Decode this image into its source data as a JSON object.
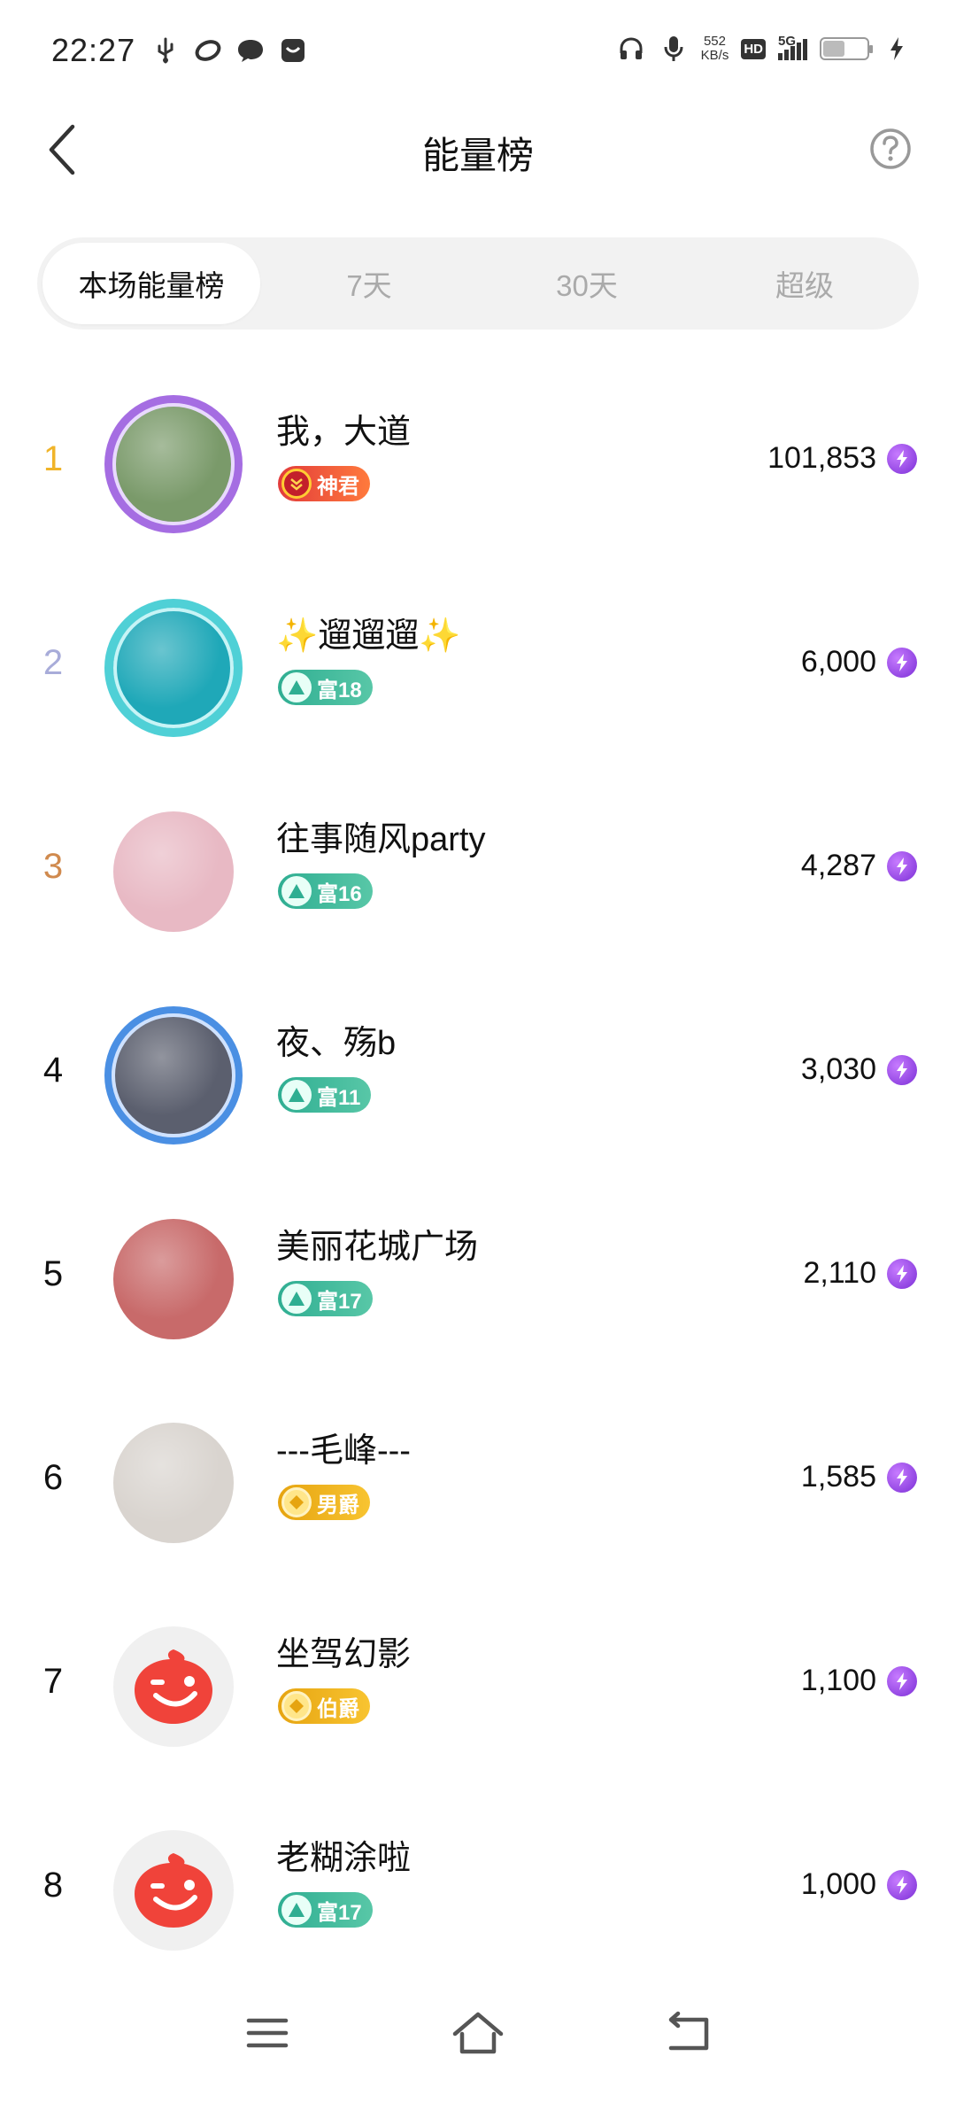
{
  "status_bar": {
    "time": "22:27",
    "left_icons": [
      "usb-icon",
      "link-icon",
      "chat-bubble-icon",
      "app-icon"
    ],
    "speed_value": "552",
    "speed_unit": "KB/s",
    "hd_label": "HD",
    "network_label": "5G",
    "battery_level": 0.5
  },
  "header": {
    "title": "能量榜"
  },
  "tabs": [
    {
      "label": "本场能量榜",
      "active": true
    },
    {
      "label": "7天",
      "active": false
    },
    {
      "label": "30天",
      "active": false
    },
    {
      "label": "超级",
      "active": false
    }
  ],
  "rankings": [
    {
      "rank": "1",
      "name": "我，大道",
      "badge": "神君",
      "badge_type": "red",
      "energy": "101,853",
      "avatar_frame": "purple",
      "avatar_color": "#7a9a6a"
    },
    {
      "rank": "2",
      "name": "✨遛遛遛✨",
      "badge": "富18",
      "badge_type": "green",
      "energy": "6,000",
      "avatar_frame": "teal",
      "avatar_color": "#1fa8b8"
    },
    {
      "rank": "3",
      "name": "往事随风party",
      "badge": "富16",
      "badge_type": "green",
      "energy": "4,287",
      "avatar_frame": "none",
      "avatar_color": "#e8b9c4"
    },
    {
      "rank": "4",
      "name": "夜、殇b",
      "badge": "富11",
      "badge_type": "green",
      "energy": "3,030",
      "avatar_frame": "blue",
      "avatar_color": "#5b5f6e"
    },
    {
      "rank": "5",
      "name": "美丽花城广场",
      "badge": "富17",
      "badge_type": "green",
      "energy": "2,110",
      "avatar_frame": "none",
      "avatar_color": "#c86a6a"
    },
    {
      "rank": "6",
      "name": "---毛峰---",
      "badge": "男爵",
      "badge_type": "gold",
      "energy": "1,585",
      "avatar_frame": "none",
      "avatar_color": "#d9d4cf"
    },
    {
      "rank": "7",
      "name": "坐驾幻影",
      "badge": "伯爵",
      "badge_type": "gold",
      "energy": "1,100",
      "avatar_frame": "none",
      "avatar_color": "default"
    },
    {
      "rank": "8",
      "name": "老糊涂啦",
      "badge": "富17",
      "badge_type": "green",
      "energy": "1,000",
      "avatar_frame": "none",
      "avatar_color": "default"
    }
  ],
  "colors": {
    "rank_gold": "#f0b429",
    "rank_silver": "#a8acd9",
    "rank_bronze": "#d08a4e",
    "energy_purple": "#8a3ce0",
    "default_avatar_red": "#f0433a"
  }
}
